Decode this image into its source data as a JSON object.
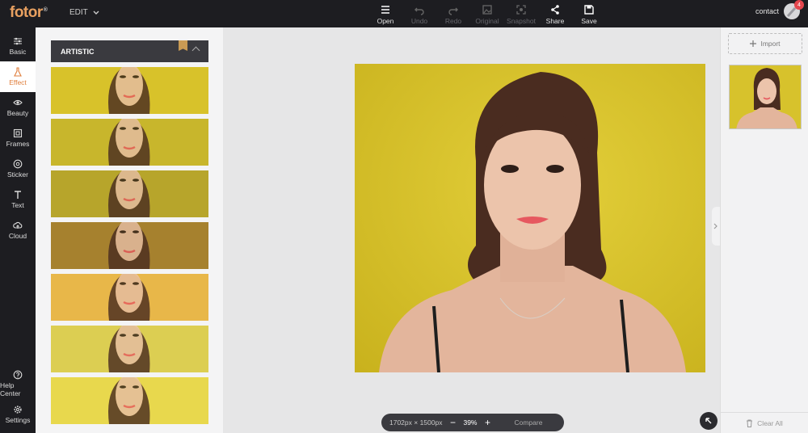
{
  "app": {
    "logo": "fotor",
    "logo_mark": "®",
    "edit_menu": "EDIT"
  },
  "toolbar": [
    {
      "label": "Open",
      "icon": "menu-icon",
      "enabled": true
    },
    {
      "label": "Undo",
      "icon": "undo-icon",
      "enabled": false
    },
    {
      "label": "Redo",
      "icon": "redo-icon",
      "enabled": false
    },
    {
      "label": "Original",
      "icon": "original-icon",
      "enabled": false
    },
    {
      "label": "Snapshot",
      "icon": "snapshot-icon",
      "enabled": false
    },
    {
      "label": "Share",
      "icon": "share-icon",
      "enabled": true
    },
    {
      "label": "Save",
      "icon": "save-icon",
      "enabled": true
    }
  ],
  "account": {
    "name": "contact",
    "notifications": "4"
  },
  "nav": [
    {
      "label": "Basic",
      "icon": "sliders-icon",
      "active": false
    },
    {
      "label": "Effect",
      "icon": "flask-icon",
      "active": true
    },
    {
      "label": "Beauty",
      "icon": "eye-icon",
      "active": false
    },
    {
      "label": "Frames",
      "icon": "frame-icon",
      "active": false
    },
    {
      "label": "Sticker",
      "icon": "sticker-icon",
      "active": false
    },
    {
      "label": "Text",
      "icon": "text-icon",
      "active": false
    },
    {
      "label": "Cloud",
      "icon": "cloud-icon",
      "active": false
    }
  ],
  "nav_bottom": [
    {
      "label": "Help Center",
      "icon": "help-icon"
    },
    {
      "label": "Settings",
      "icon": "gear-icon"
    }
  ],
  "effect_panel": {
    "section_title": "ARTISTIC",
    "thumbnails": [
      {
        "tint": "#d8c32a"
      },
      {
        "tint": "#c9b62d"
      },
      {
        "tint": "#b8a52b"
      },
      {
        "tint": "#a7822f"
      },
      {
        "tint": "#e8b84a"
      },
      {
        "tint": "#dccf52"
      },
      {
        "tint": "#e8d84e"
      }
    ]
  },
  "canvas": {
    "dimensions": "1702px × 1500px",
    "zoom": "39%",
    "compare_label": "Compare",
    "zoom_out": "−",
    "zoom_in": "+"
  },
  "right_panel": {
    "import_label": "Import",
    "clear_label": "Clear All"
  },
  "colors": {
    "background_yellow": "#d7c22c",
    "accent": "#e07e3c",
    "dark": "#1d1d21"
  }
}
